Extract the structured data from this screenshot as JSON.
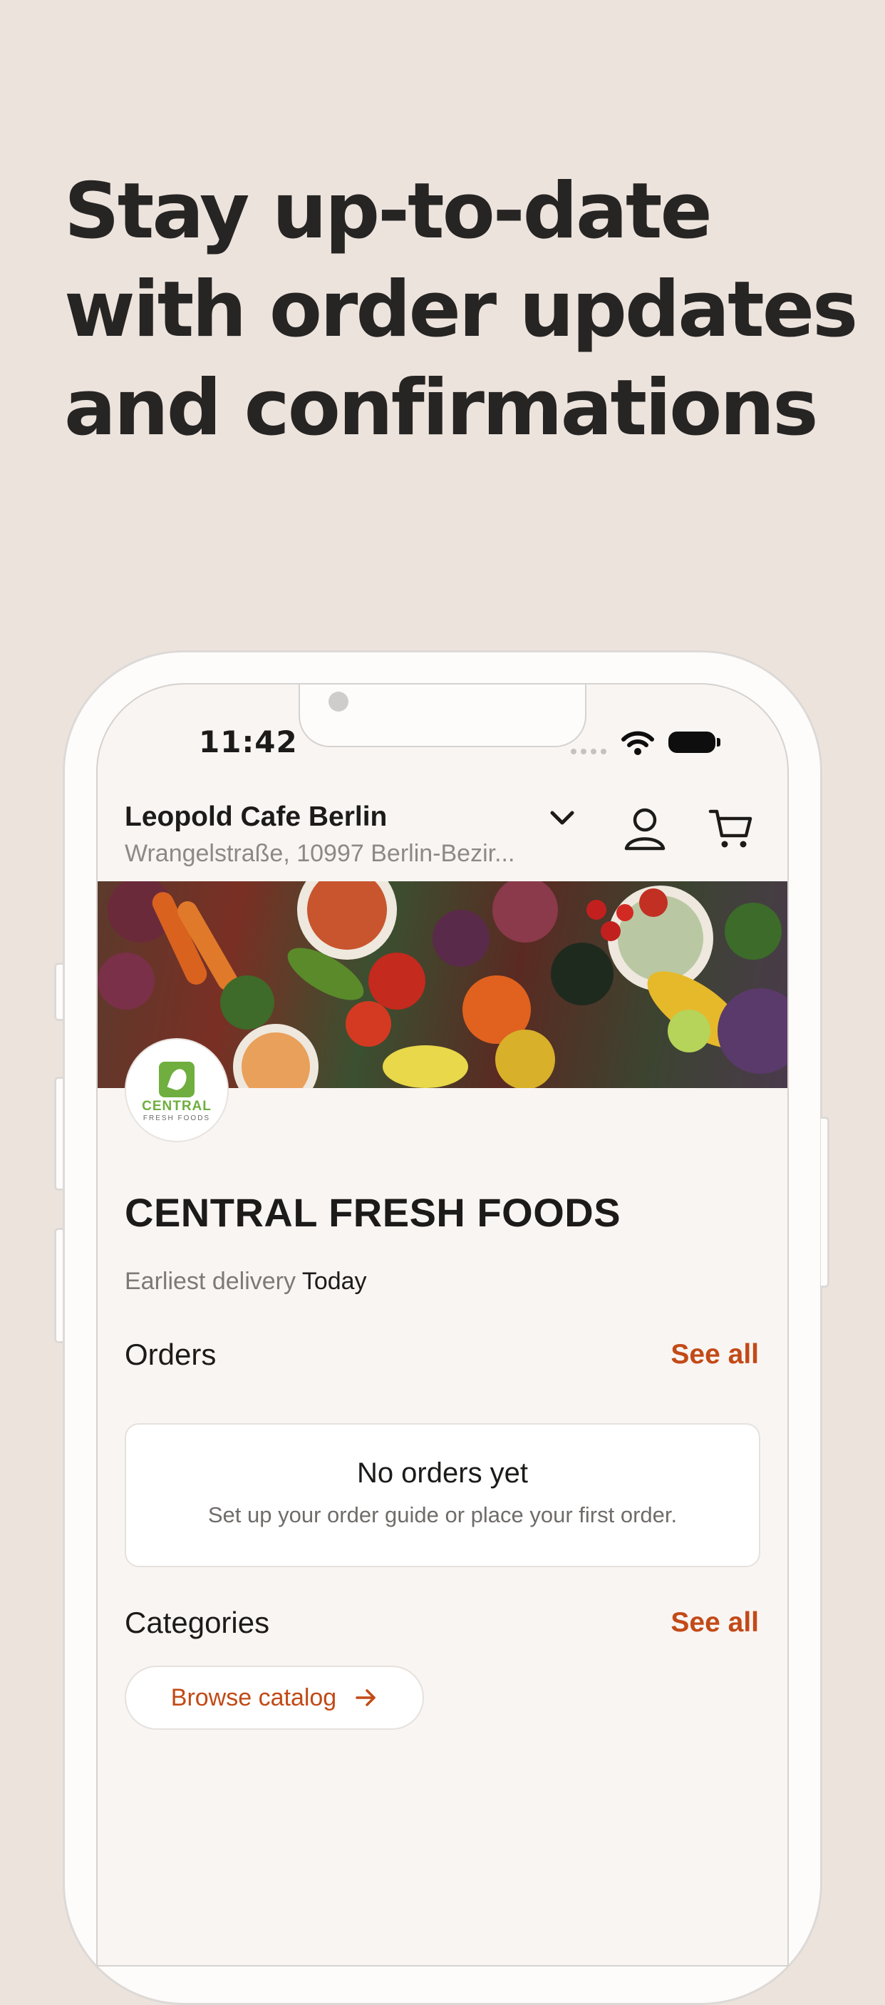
{
  "headline": {
    "lines": [
      "Stay up-to-date",
      "with order updates",
      "and confirmations"
    ]
  },
  "status_bar": {
    "time": "11:42"
  },
  "location": {
    "name": "Leopold Cafe Berlin",
    "address": "Wrangelstraße, 10997 Berlin-Bezir..."
  },
  "icons": {
    "dropdown": "chevron-down-icon",
    "account": "user-icon",
    "cart": "cart-icon",
    "wifi": "wifi-icon",
    "battery": "battery-icon"
  },
  "supplier": {
    "logo_text_main": "CENTRAL",
    "logo_text_sub": "FRESH FOODS",
    "name": "CENTRAL FRESH FOODS",
    "delivery_label": "Earliest delivery",
    "delivery_value": "Today"
  },
  "orders": {
    "title": "Orders",
    "see_all": "See all",
    "empty_title": "No orders yet",
    "empty_subtitle": "Set up your order guide or place your first order."
  },
  "categories": {
    "title": "Categories",
    "see_all": "See all",
    "browse_label": "Browse catalog"
  },
  "colors": {
    "background": "#ede3dd",
    "accent": "#c24a17",
    "logo_green": "#6fae3f"
  }
}
